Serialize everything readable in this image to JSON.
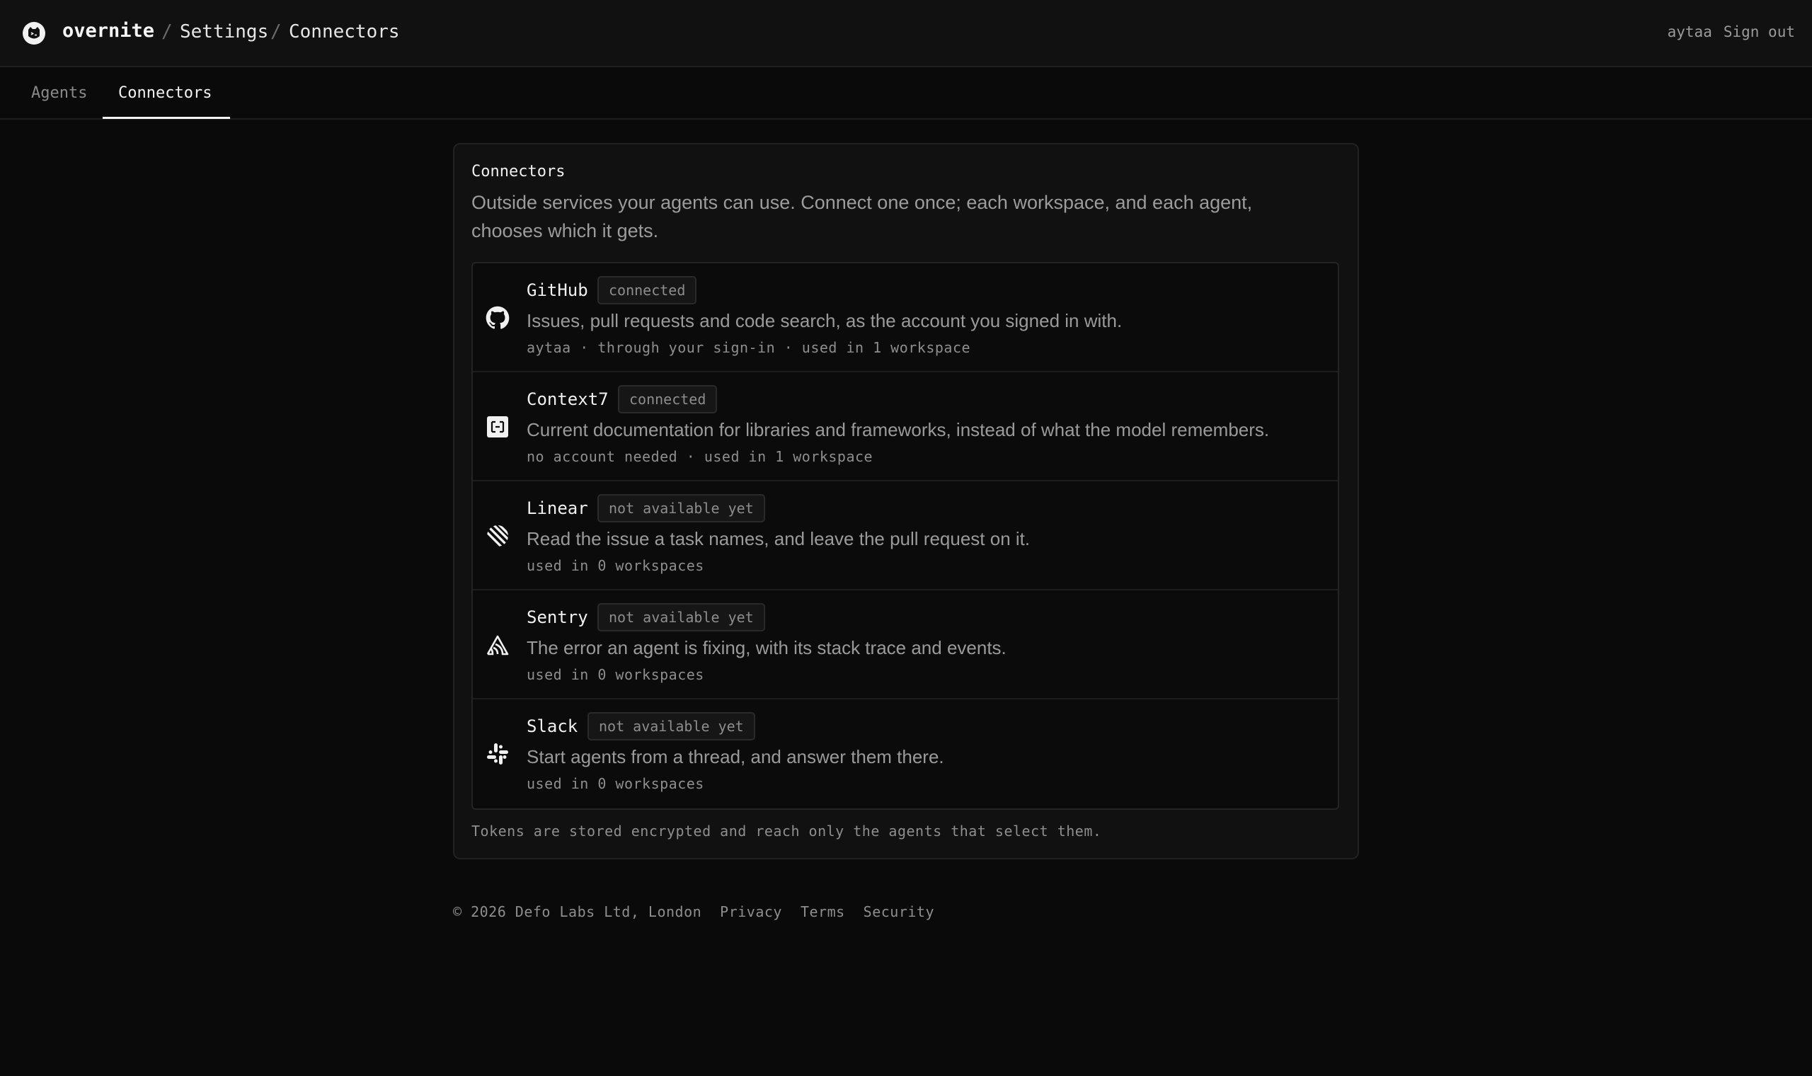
{
  "header": {
    "brand": "overnite",
    "breadcrumb": [
      "Settings",
      "Connectors"
    ],
    "separator": "/",
    "user": "aytaa",
    "sign_out": "Sign out"
  },
  "tabs": [
    {
      "label": "Agents",
      "active": false
    },
    {
      "label": "Connectors",
      "active": true
    }
  ],
  "card": {
    "title": "Connectors",
    "description": "Outside services your agents can use. Connect one once; each workspace, and each agent, chooses which it gets.",
    "footnote": "Tokens are stored encrypted and reach only the agents that select them."
  },
  "connectors": [
    {
      "name": "GitHub",
      "icon": "github-icon",
      "status": "connected",
      "description": "Issues, pull requests and code search, as the account you signed in with.",
      "meta": "aytaa · through your sign-in · used in 1 workspace"
    },
    {
      "name": "Context7",
      "icon": "context7-icon",
      "status": "connected",
      "description": "Current documentation for libraries and frameworks, instead of what the model remembers.",
      "meta": "no account needed · used in 1 workspace"
    },
    {
      "name": "Linear",
      "icon": "linear-icon",
      "status": "not available yet",
      "description": "Read the issue a task names, and leave the pull request on it.",
      "meta": "used in 0 workspaces"
    },
    {
      "name": "Sentry",
      "icon": "sentry-icon",
      "status": "not available yet",
      "description": "The error an agent is fixing, with its stack trace and events.",
      "meta": "used in 0 workspaces"
    },
    {
      "name": "Slack",
      "icon": "slack-icon",
      "status": "not available yet",
      "description": "Start agents from a thread, and answer them there.",
      "meta": "used in 0 workspaces"
    }
  ],
  "footer": {
    "copyright": "© 2026 Defo Labs Ltd, London",
    "links": [
      "Privacy",
      "Terms",
      "Security"
    ]
  }
}
